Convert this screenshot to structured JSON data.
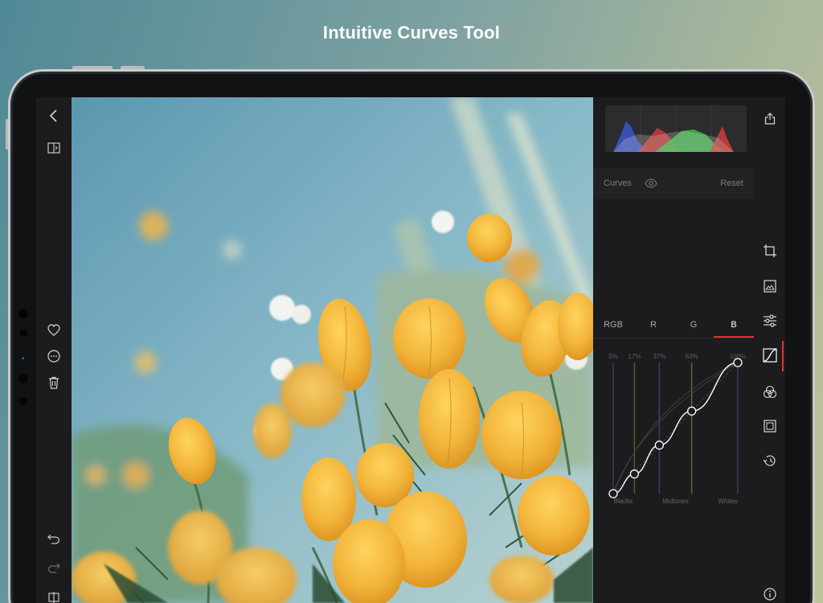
{
  "headline": "Intuitive Curves Tool",
  "left_toolbar": {
    "back": "chevron-left-icon",
    "compare": "compare-icon",
    "favorite": "heart-icon",
    "more": "ellipsis-icon",
    "delete": "trash-icon",
    "undo": "undo-icon",
    "redo": "redo-icon",
    "split": "split-view-icon"
  },
  "panel": {
    "curves_title": "Curves",
    "visibility_icon": "eye-icon",
    "reset_label": "Reset",
    "channels": [
      "RGB",
      "R",
      "G",
      "B"
    ],
    "active_channel": "B",
    "percent_labels": [
      "0%",
      "17%",
      "37%",
      "63%",
      "100%"
    ],
    "zone_labels": [
      "Blacks",
      "Midtones",
      "Whites"
    ],
    "curve_points": [
      {
        "in": 0,
        "out": 0
      },
      {
        "in": 17,
        "out": 15
      },
      {
        "in": 37,
        "out": 37
      },
      {
        "in": 63,
        "out": 63
      },
      {
        "in": 100,
        "out": 100
      }
    ]
  },
  "right_toolbar": {
    "share": "share-icon",
    "crop": "crop-icon",
    "adjust_image": "image-adjust-icon",
    "sliders": "sliders-icon",
    "curves": "curves-icon",
    "color_mixer": "color-circles-icon",
    "frame": "frame-icon",
    "history": "history-icon",
    "info": "info-icon"
  },
  "colors": {
    "accent": "#e0322b",
    "panel_bg": "#1c1c1e",
    "blue_channel": "#3a54c4",
    "red_channel": "#c93a36",
    "green_channel": "#3fb14a"
  }
}
